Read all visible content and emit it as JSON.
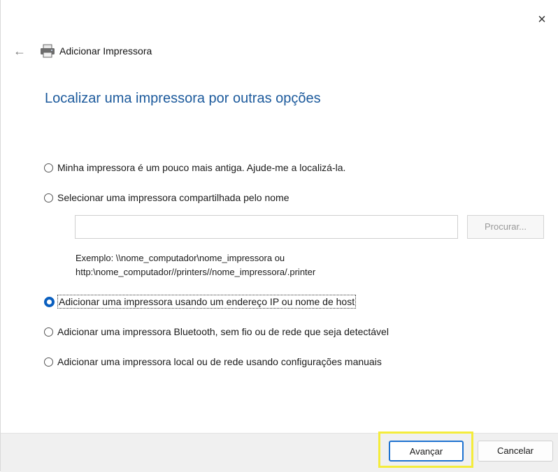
{
  "window": {
    "close_icon": "×",
    "back_icon": "←",
    "title": "Adicionar Impressora"
  },
  "page": {
    "heading": "Localizar uma impressora por outras opções"
  },
  "options": [
    {
      "label": "Minha impressora é um pouco mais antiga. Ajude-me a localizá-la.",
      "checked": false
    },
    {
      "label": "Selecionar uma impressora compartilhada pelo nome",
      "checked": false
    },
    {
      "label": "Adicionar uma impressora usando um endereço IP ou nome de host",
      "checked": true
    },
    {
      "label": "Adicionar uma impressora Bluetooth, sem fio ou de rede que seja detectável",
      "checked": false
    },
    {
      "label": "Adicionar uma impressora local ou de rede usando configurações manuais",
      "checked": false
    }
  ],
  "shared_name": {
    "value": "",
    "browse_label": "Procurar...",
    "example_line1": "Exemplo: \\\\nome_computador\\nome_impressora ou",
    "example_line2": "http:\\nome_computador//printers//nome_impressora/.printer"
  },
  "footer": {
    "next_label": "Avançar",
    "cancel_label": "Cancelar"
  },
  "colors": {
    "heading": "#1c5a9c",
    "radio_selected": "#0a5fbf",
    "highlight": "#f4ec3b"
  }
}
